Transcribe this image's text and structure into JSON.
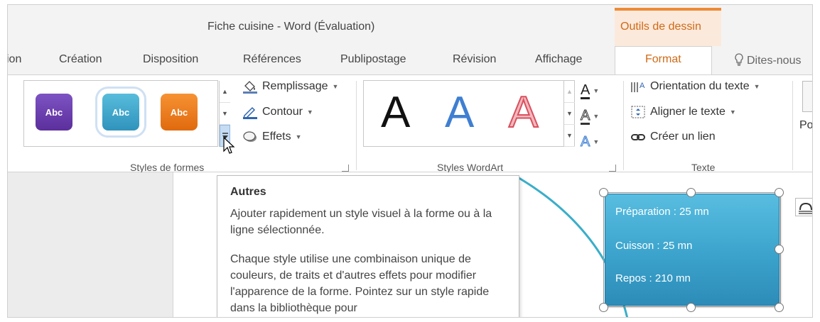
{
  "window": {
    "title": "Fiche cuisine - Word (Évaluation)",
    "contextual_tab_group": "Outils de dessin"
  },
  "tabs": [
    {
      "label": "ion"
    },
    {
      "label": "Création"
    },
    {
      "label": "Disposition"
    },
    {
      "label": "Références"
    },
    {
      "label": "Publipostage"
    },
    {
      "label": "Révision"
    },
    {
      "label": "Affichage"
    },
    {
      "label": "Format",
      "active": true
    }
  ],
  "tell_me": "Dites-nous",
  "ribbon": {
    "shape_styles": {
      "group_label": "Styles de formes",
      "thumbnails": [
        {
          "label": "Abc",
          "color": "#6a3bb0"
        },
        {
          "label": "Abc",
          "color": "#3fa6c8"
        },
        {
          "label": "Abc",
          "color": "#ef7b1b"
        }
      ],
      "fill": "Remplissage",
      "outline": "Contour",
      "effects": "Effets"
    },
    "wordart": {
      "group_label": "Styles WordArt",
      "letters": [
        {
          "label": "A",
          "color": "#111111"
        },
        {
          "label": "A",
          "color": "#3f7fd1"
        },
        {
          "label": "A",
          "color": "#ee9aa3"
        }
      ],
      "tool_glyph": "A"
    },
    "text": {
      "group_label": "Texte",
      "direction": "Orientation du texte",
      "align": "Aligner le texte",
      "link": "Créer un lien"
    },
    "position_partial": "Pos"
  },
  "tooltip": {
    "title": "Autres",
    "paragraph1": "Ajouter rapidement un style visuel à la forme ou à la ligne sélectionnée.",
    "paragraph2": "Chaque style utilise une combinaison unique de couleurs, de traits et d'autres effets pour modifier l'apparence de la forme. Pointez sur un style rapide dans la bibliothèque pour"
  },
  "shape": {
    "line1": "Préparation : 25 mn",
    "line2": "Cuisson : 25 mn",
    "line3": "Repos : 210 mn",
    "fill": "#3fa6cf"
  },
  "colors": {
    "accent": "#d06a16",
    "context_band": "#fbe9dc",
    "selection": "#c5dcf3"
  }
}
